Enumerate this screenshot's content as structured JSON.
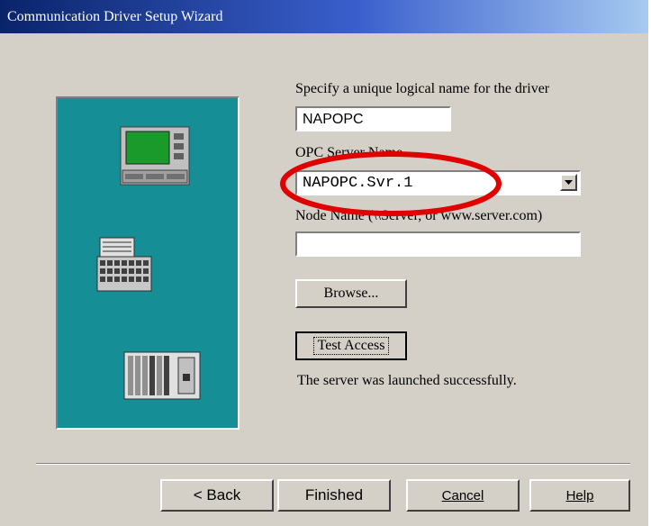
{
  "window": {
    "title": "Communication Driver Setup Wizard"
  },
  "form": {
    "logical_name_label": "Specify a unique logical name for the driver",
    "logical_name_value": "NAPOPC",
    "opc_server_label": "OPC Server Name",
    "opc_server_value": "NAPOPC.Svr.1",
    "node_name_label": "Node Name (\\\\Server, or www.server.com)",
    "node_name_value": "",
    "browse_label": "Browse...",
    "test_access_label": "Test Access",
    "status_text": "The server was launched successfully."
  },
  "footer": {
    "back_label": "< Back",
    "finished_label": "Finished",
    "cancel_label": "Cancel",
    "help_label": "Help"
  },
  "colors": {
    "panel": "#158e96",
    "highlight_ellipse": "#e00000",
    "dialog": "#d4d0c8"
  },
  "icons": [
    "operator-panel-icon",
    "keyboard-terminal-icon",
    "plc-rack-icon",
    "dropdown-arrow-icon"
  ]
}
